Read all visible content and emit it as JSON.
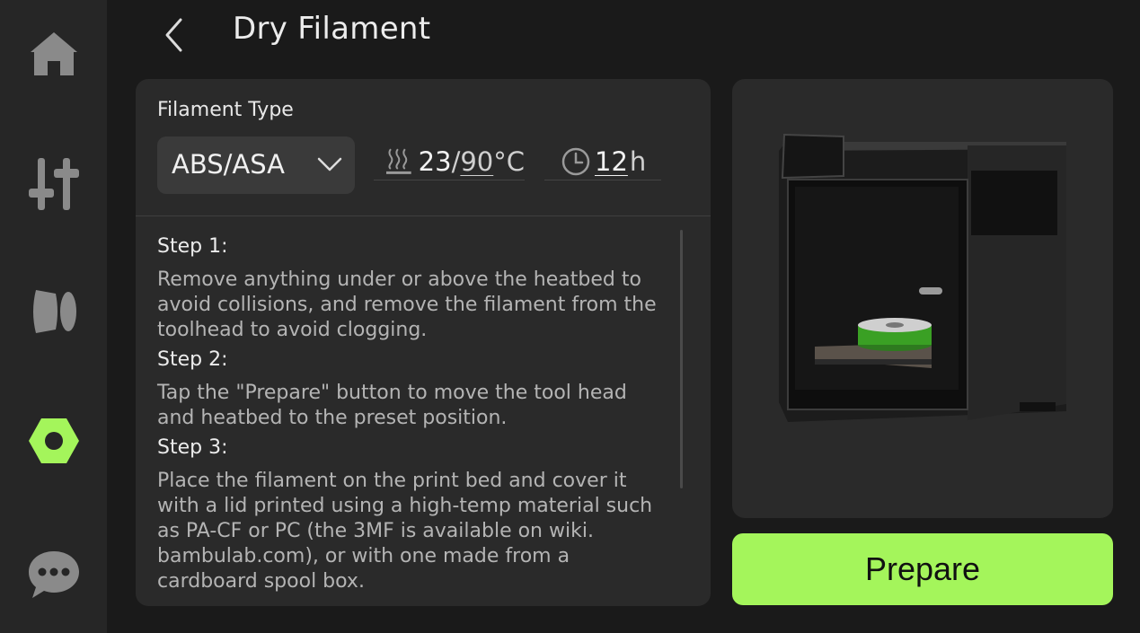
{
  "header": {
    "title": "Dry Filament"
  },
  "sidebar": {
    "items": [
      {
        "icon": "home-icon",
        "active": false
      },
      {
        "icon": "controls-icon",
        "active": false
      },
      {
        "icon": "filament-icon",
        "active": false
      },
      {
        "icon": "settings-icon",
        "active": true
      },
      {
        "icon": "chat-icon",
        "active": false
      }
    ]
  },
  "filament": {
    "label": "Filament Type",
    "selected": "ABS/ASA"
  },
  "temperature": {
    "current": "23",
    "separator": "/",
    "target": "90",
    "unit": "°C"
  },
  "duration": {
    "value": "12",
    "unit": "h"
  },
  "steps": [
    {
      "title": "Step 1:",
      "text": "Remove anything under or above the heatbed to avoid collisions, and remove the filament from the toolhead to avoid clogging."
    },
    {
      "title": "Step 2:",
      "text": "Tap the \"Prepare\" button to move the tool head and heatbed to the preset position."
    },
    {
      "title": "Step 3:",
      "text": "Place the filament on the print bed and cover it with a lid printed using a high-temp material such as PA-CF or PC (the 3MF is available on wiki. bambulab.com), or with one made from a cardboard spool box."
    }
  ],
  "actions": {
    "prepare_label": "Prepare"
  },
  "colors": {
    "accent": "#a4f55b",
    "background": "#1a1a1a",
    "panel": "#2a2a2a",
    "sidebar": "#262626"
  }
}
